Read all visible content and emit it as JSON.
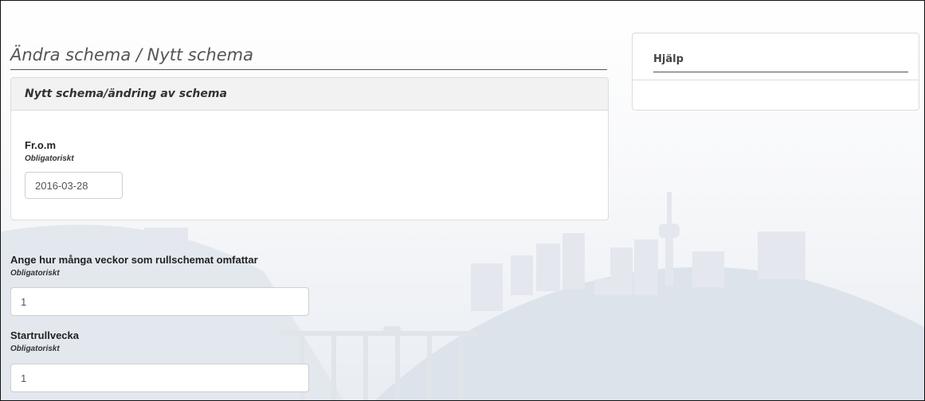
{
  "page": {
    "title": "Ändra schema / Nytt schema"
  },
  "panel": {
    "header": "Nytt schema/ändring av schema",
    "from_field": {
      "label": "Fr.o.m",
      "required": "Obligatoriskt",
      "value": "2016-03-28"
    }
  },
  "weeks_field": {
    "label": "Ange hur många veckor som rullschemat omfattar",
    "required": "Obligatoriskt",
    "value": "1"
  },
  "start_week_field": {
    "label": "Startrullvecka",
    "required": "Obligatoriskt",
    "value": "1"
  },
  "help": {
    "title": "Hjälp"
  },
  "colors": {
    "border": "#dcdcdc",
    "panel_header_bg": "#f2f2f2",
    "background_scene": "#dfe5ec"
  }
}
